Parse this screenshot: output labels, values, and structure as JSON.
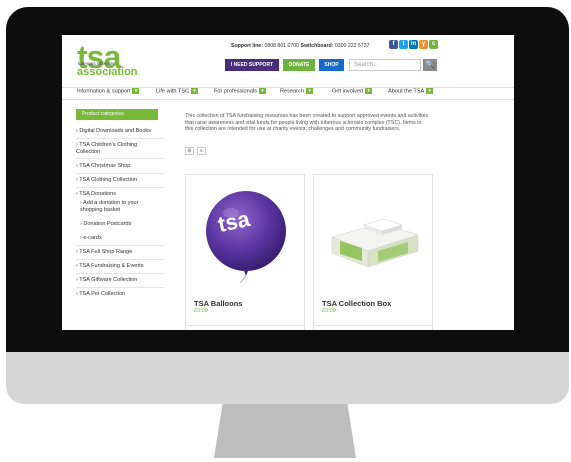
{
  "header": {
    "logo_main": "tsa",
    "logo_sub": "tuberous sclerosis",
    "logo_assoc": "association",
    "support_label": "Support line:",
    "support_number": "0808 801 0700",
    "switchboard_label": "Switchboard:",
    "switchboard_number": "0300 222 5737",
    "social": [
      "f",
      "t",
      "in",
      "y",
      "c"
    ],
    "btn_need_support": "I NEED SUPPORT",
    "btn_donate": "DONATE",
    "btn_shop": "SHOP",
    "search_placeholder": "Search...",
    "search_icon": "🔍"
  },
  "nav": [
    "Information & support",
    "Life with TSC",
    "For professionals",
    "Research",
    "Get involved",
    "About the TSA"
  ],
  "sidebar": {
    "heading": "Product categories",
    "items": [
      "› Digital Downloads and Books",
      "› TSA Children's Clothing Collection",
      "› TSA Christmas Shop",
      "› TSA Clothing Collection",
      "› TSA Donations",
      "› Add a donation to your shopping basket",
      "› Donation Postcards",
      "› e-cards",
      "› TSA Full Shop Range",
      "› TSA Fundraising & Events",
      "› TSA Giftware Collection",
      "› TSA Pet Collection"
    ]
  },
  "main": {
    "intro": "This collection of TSA fundraising resources has been created to support approved events and activities that raise awareness and vital funds for people living with tuberous sclerosis complex (TSC). Items in this collection are intended for use at charity events, challenges and community fundraisers.",
    "view_grid": "⊞",
    "view_list": "≡",
    "products": [
      {
        "title": "TSA Balloons",
        "price": "£0.00",
        "balloon_text": "tsa"
      },
      {
        "title": "TSA Collection Box",
        "price": "£0.00"
      }
    ]
  },
  "colors": {
    "brand_green": "#7ab83a",
    "purple": "#4a2d7a",
    "donate_green": "#6cb33f",
    "shop_blue": "#1769c7"
  }
}
